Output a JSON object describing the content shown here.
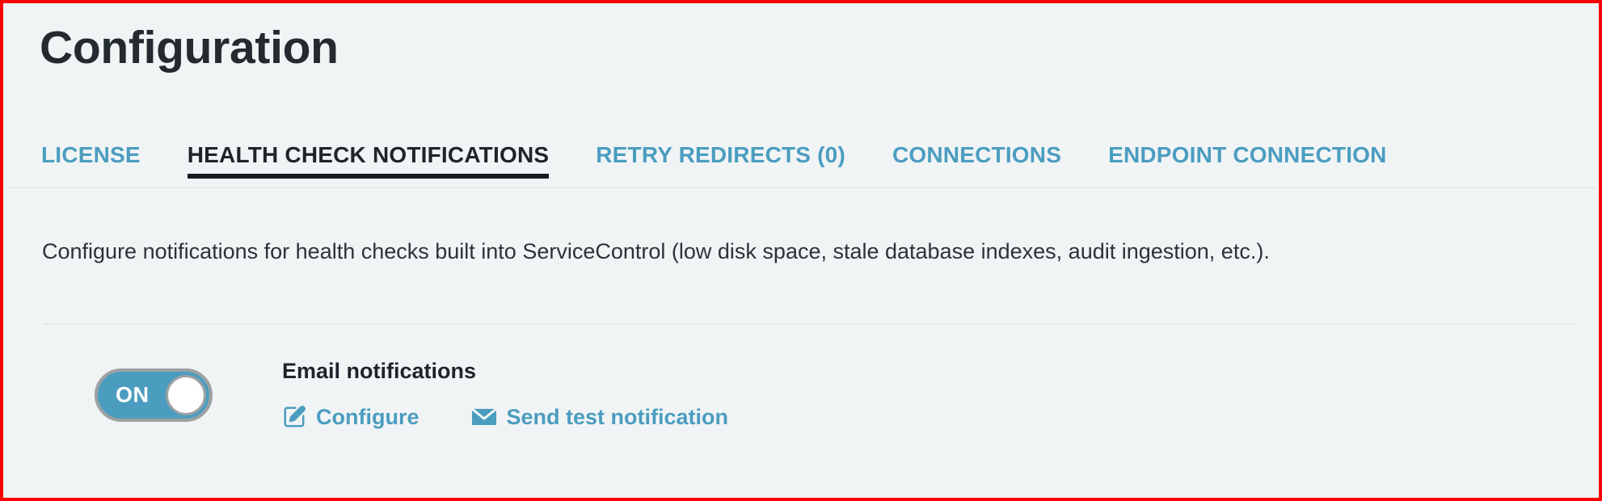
{
  "page": {
    "title": "Configuration",
    "accent_color": "#4b9dc0",
    "active_text_color": "#1d252b",
    "background_color": "#f1f4f5",
    "border_color": "#fb0007"
  },
  "tabs": [
    {
      "label": "LICENSE",
      "active": false
    },
    {
      "label": "HEALTH CHECK NOTIFICATIONS",
      "active": true
    },
    {
      "label": "RETRY REDIRECTS (0)",
      "active": false
    },
    {
      "label": "CONNECTIONS",
      "active": false
    },
    {
      "label": "ENDPOINT CONNECTION",
      "active": false
    }
  ],
  "panel": {
    "description": "Configure notifications for health checks built into ServiceControl (low disk space, stale database indexes, audit ingestion, etc.).",
    "setting": {
      "toggle_state": "ON",
      "name": "Email notifications",
      "actions": [
        {
          "label": "Configure",
          "icon": "edit-pencil-square-icon"
        },
        {
          "label": "Send test notification",
          "icon": "envelope-icon"
        }
      ]
    }
  }
}
